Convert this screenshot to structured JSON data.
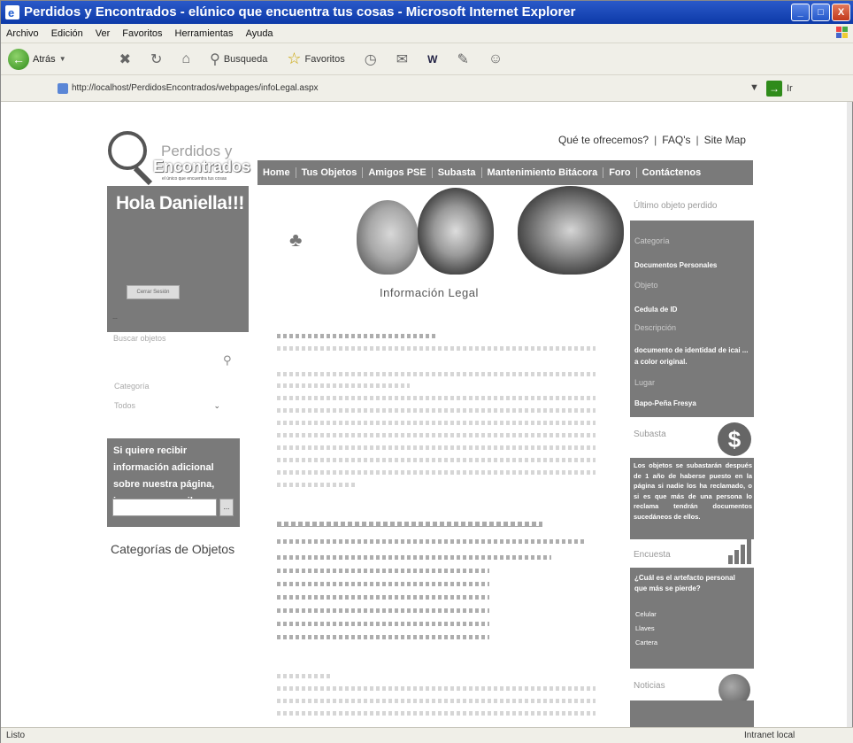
{
  "window": {
    "title": "Perdidos y Encontrados - elúnico que encuentra tus cosas - Microsoft Internet Explorer",
    "controls": {
      "minimize": "_",
      "maximize": "□",
      "close": "X"
    }
  },
  "menu": [
    "Archivo",
    "Edición",
    "Ver",
    "Favoritos",
    "Herramientas",
    "Ayuda"
  ],
  "toolbar": {
    "back_label": "Atrás",
    "search_label": "Busqueda",
    "favorites_label": "Favoritos"
  },
  "address": {
    "url": "http://localhost/PerdidosEncontrados/webpages/infoLegal.aspx",
    "go_label": "Ir"
  },
  "site": {
    "logo": {
      "line1": "Perdidos y",
      "line2": "Encontrados",
      "tagline": "el único que encuentra tus cosas"
    },
    "top_links": [
      "Qué te ofrecemos?",
      "FAQ's",
      "Site Map"
    ],
    "nav": [
      "Home",
      "Tus Objetos",
      "Amigos PSE",
      "Subasta",
      "Mantenimiento Bitácora",
      "Foro",
      "Contáctenos"
    ],
    "greeting": "Hola Daniella!!!",
    "logout_button": "Cerrar Sesión",
    "search_label": "Buscar objetos",
    "category_label": "Categoría",
    "category_value": "Todos",
    "subscribe_text": "Si quiere recibir información adicional sobre nuestra página, ingrese su e-mail:",
    "subscribe_button": "...",
    "categories_title": "Categorías de Objetos",
    "page_title": "Información Legal",
    "right": {
      "last_lost_title": "Último objeto perdido",
      "category_label": "Categoría",
      "category_value": "Documentos Personales",
      "object_label": "Objeto",
      "object_value": "Cedula de ID",
      "description_label": "Descripción",
      "description_value": "documento de identidad de icai ... a color original.",
      "place_label": "Lugar",
      "place_value": "Bapo-Peña Fresya",
      "subasta_title": "Subasta",
      "subasta_text": "Los objetos se subastarán después de 1 año de haberse puesto en la página si nadie los ha reclamado, o si es que más de una persona lo reclama tendrán documentos sucedáneos de ellos.",
      "survey_title": "Encuesta",
      "survey_question": "¿Cuál es el artefacto personal que más se pierde?",
      "survey_options": [
        "Celular",
        "Llaves",
        "Cartera"
      ],
      "last_title": "Noticias"
    }
  },
  "status": {
    "left": "Listo",
    "zone": "Intranet local"
  }
}
